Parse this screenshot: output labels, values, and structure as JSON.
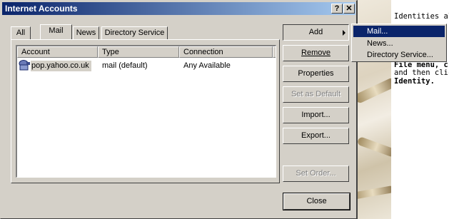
{
  "dialog": {
    "title": "Internet Accounts"
  },
  "titlebar": {
    "help_glyph": "?",
    "close_glyph": "✕"
  },
  "tabs": [
    {
      "label": "All"
    },
    {
      "label": "Mail"
    },
    {
      "label": "News"
    },
    {
      "label": "Directory Service"
    }
  ],
  "list": {
    "columns": [
      "Account",
      "Type",
      "Connection"
    ],
    "rows": [
      {
        "account": "pop.yahoo.co.uk",
        "type": "mail (default)",
        "connection": "Any Available",
        "icon": "mail-account-icon"
      }
    ]
  },
  "buttons": {
    "add": "Add",
    "remove": "Remove",
    "properties": "Properties",
    "set_default": "Set as Default",
    "import": "Import...",
    "export": "Export...",
    "set_order": "Set Order...",
    "close": "Close"
  },
  "popup_menu": {
    "items": [
      "Mail...",
      "News...",
      "Directory Service..."
    ],
    "highlighted": "Mail..."
  },
  "help_text": {
    "line1": "Identities allo",
    "line2": "File menu, c",
    "line3": "and then click",
    "line4": "Identity."
  }
}
